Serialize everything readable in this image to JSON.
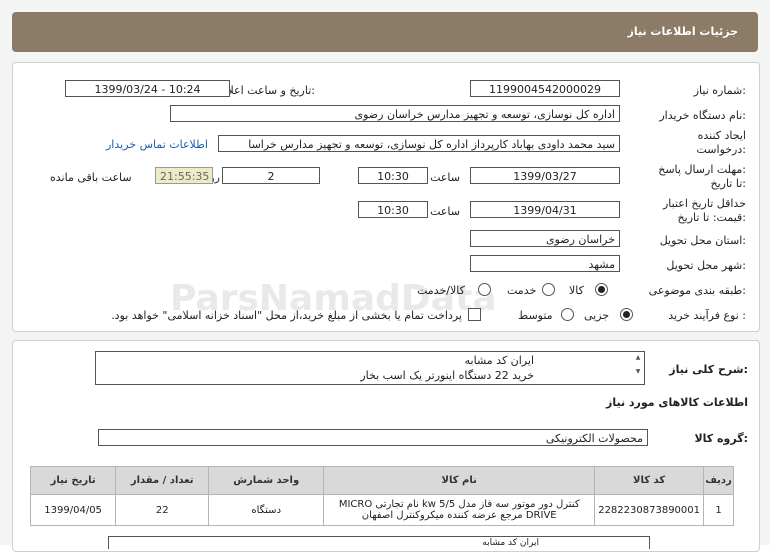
{
  "header": {
    "title": "جزئیات اطلاعات نیاز"
  },
  "form": {
    "need_number_label": "شماره نیاز:",
    "need_number": "1199004542000029",
    "announce_label": "تاریخ و ساعت اعلان عمومی:",
    "announce_value": "1399/03/24 - 10:24",
    "buyer_org_label": "نام دستگاه خریدار:",
    "buyer_org": "اداره کل نوسازی، توسعه و تجهیز مدارس خراسان رضوی",
    "creator_label_1": "ایجاد کننده",
    "creator_label_2": "درخواست:",
    "creator": "سید محمد داودی بهاباد کارپرداز اداره کل نوسازی، توسعه و تجهیز مدارس خراسا",
    "contact_link": "اطلاعات تماس خریدار",
    "reply_label_1": "مهلت ارسال پاسخ:",
    "reply_label_2": "تا تاریخ:",
    "reply_date": "1399/03/27",
    "time_label": "ساعت",
    "reply_time": "10:30",
    "days_value": "2",
    "days_label": "روز و",
    "countdown": "21:55:35",
    "remaining_label": "ساعت باقی مانده",
    "validity_label_1": "حداقل تاریخ اعتبار",
    "validity_label_2": "قیمت: تا تاریخ:",
    "validity_date": "1399/04/31",
    "validity_time_label": "ساعت",
    "validity_time": "10:30",
    "province_label": "استان محل تحویل:",
    "province": "خراسان رضوی",
    "city_label": "شهر محل تحویل:",
    "city": "مشهد",
    "category_label": "طبقه بندی موضوعی:",
    "category_options": [
      "کالا",
      "خدمت",
      "کالا/خدمت"
    ],
    "process_label": "نوع فرآیند خرید :",
    "process_options": [
      "جزیی",
      "متوسط"
    ],
    "payment_note": "پرداخت تمام یا بخشی از مبلغ خرید،از محل \"اسناد خزانه اسلامی\" خواهد بود."
  },
  "description": {
    "label": "شرح کلی نیاز:",
    "line1": "ایران کد مشابه",
    "line2": "خرید 22 دستگاه اینورتر یک اسب بخار"
  },
  "goods": {
    "section_title": "اطلاعات کالاهای مورد نیاز",
    "group_label": "گروه کالا:",
    "group_value": "محصولات الکترونیکی",
    "columns": [
      "ردیف",
      "کد کالا",
      "نام کالا",
      "واحد شمارش",
      "تعداد / مقدار",
      "تاریخ نیاز"
    ],
    "row": {
      "index": "1",
      "code": "2282230873890001",
      "name_1": "کنترل دور موتور سه فاز مدل kw 5/5 نام تجارتی MICRO",
      "name_2": "DRIVE مرجع عرضه کننده میکروکنترل اصفهان",
      "unit": "دستگاه",
      "qty": "22",
      "date": "1399/04/05"
    }
  },
  "bottom": {
    "partial_text": "ایران کد مشابه"
  },
  "watermark": {
    "text": "ParsNamadData"
  }
}
